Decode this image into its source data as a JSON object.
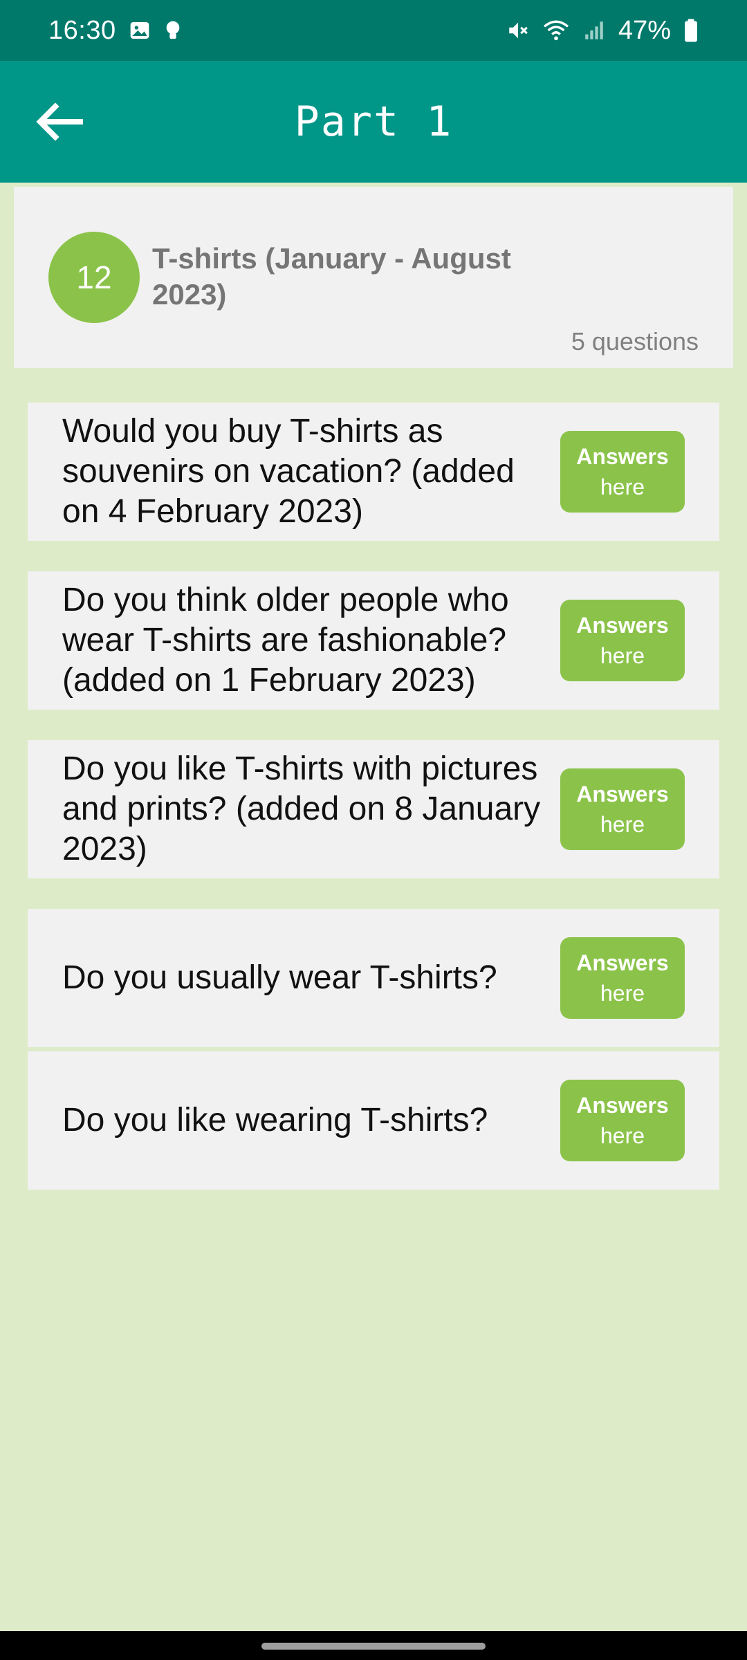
{
  "status_bar": {
    "time": "16:30",
    "battery_pct": "47%",
    "icons_left": [
      "image-icon",
      "bulb-icon"
    ],
    "icons_right": [
      "mute-icon",
      "wifi-icon",
      "signal-icon",
      "battery-icon"
    ]
  },
  "app_bar": {
    "title": "Part 1",
    "back_icon": "arrow-left-icon"
  },
  "topic": {
    "number": "12",
    "title": "T-shirts (January - August 2023)",
    "count_label": "5 questions"
  },
  "questions": [
    {
      "text": "Would you buy T-shirts as souvenirs on vacation? (added on 4 February 2023)",
      "button_label": "Answers",
      "button_sub": "here"
    },
    {
      "text": "Do you think older people who wear T-shirts are fashionable? (added on 1 February 2023)",
      "button_label": "Answers",
      "button_sub": "here"
    },
    {
      "text": "Do you like T-shirts with pictures and prints? (added on 8 January 2023)",
      "button_label": "Answers",
      "button_sub": "here"
    },
    {
      "text": "Do you usually wear T-shirts?",
      "button_label": "Answers",
      "button_sub": "here"
    },
    {
      "text": "Do you like wearing T-shirts?",
      "button_label": "Answers",
      "button_sub": "here"
    }
  ],
  "colors": {
    "status_bar": "#00796b",
    "app_bar": "#009688",
    "accent_green": "#8bc34a",
    "page_background": "#deebc8",
    "card_background": "#f1f1f1"
  }
}
